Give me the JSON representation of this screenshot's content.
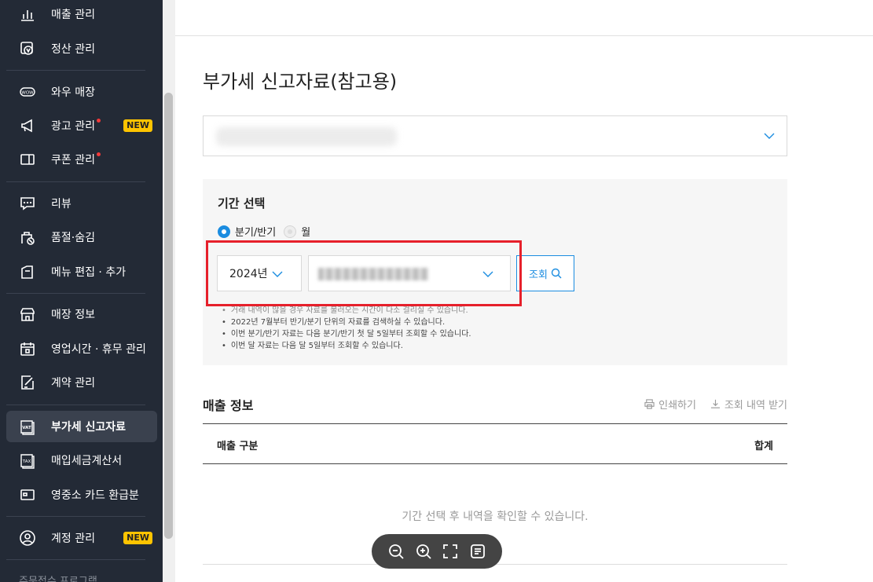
{
  "sidebar": {
    "items": [
      {
        "label": "매출 관리",
        "icon": "bar-chart-icon"
      },
      {
        "label": "정산 관리",
        "icon": "settlement-icon"
      },
      {
        "label": "와우 매장",
        "icon": "wow-icon"
      },
      {
        "label": "광고 관리",
        "icon": "megaphone-icon",
        "badge": "NEW"
      },
      {
        "label": "쿠폰 관리",
        "icon": "coupon-icon"
      },
      {
        "label": "리뷰",
        "icon": "chat-icon"
      },
      {
        "label": "품절·숨김",
        "icon": "soldout-icon"
      },
      {
        "label": "메뉴 편집 · 추가",
        "icon": "menu-edit-icon"
      },
      {
        "label": "매장 정보",
        "icon": "store-icon"
      },
      {
        "label": "영업시간 · 휴무 관리",
        "icon": "calendar-icon"
      },
      {
        "label": "계약 관리",
        "icon": "contract-icon"
      },
      {
        "label": "부가세 신고자료",
        "icon": "vat-icon"
      },
      {
        "label": "매입세금계산서",
        "icon": "tax-icon"
      },
      {
        "label": "영중소 카드 환급분",
        "icon": "card-icon"
      },
      {
        "label": "계정 관리",
        "icon": "user-icon",
        "badge": "NEW"
      }
    ],
    "footer": "주문접수 프로그램"
  },
  "main": {
    "title": "부가세 신고자료(참고용)",
    "period": {
      "title": "기간 선택",
      "radio_quarter": "분기/반기",
      "radio_month": "월",
      "year_value": "2024년",
      "search_label": "조회",
      "notes": [
        "거래 내역이 많을 경우 자료를 불러오는 시간이 다소 걸리실 수 있습니다.",
        "2022년 7월부터 반기/분기 단위의 자료를 검색하실 수 있습니다.",
        "이번 분기/반기 자료는 다음 분기/반기 첫 달 5일부터 조회할 수 있습니다.",
        "이번 달 자료는 다음 달 5일부터 조회할 수 있습니다."
      ]
    },
    "sales": {
      "title": "매출 정보",
      "print_label": "인쇄하기",
      "download_label": "조회 내역 받기",
      "col_category": "매출 구분",
      "col_total": "합계",
      "empty_message": "기간 선택 후 내역을 확인할 수 있습니다."
    }
  },
  "colors": {
    "sidebar_bg": "#232a36",
    "accent": "#1a8ce0",
    "highlight_box": "#e6202b",
    "new_badge": "#ffc400"
  }
}
